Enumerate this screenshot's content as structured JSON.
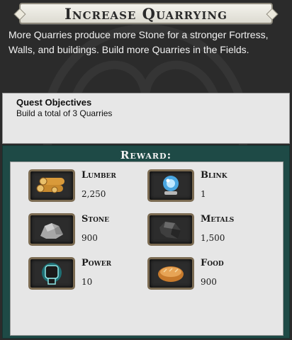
{
  "quest": {
    "title": "Increase Quarrying",
    "description": "More Quarries produce more Stone for a stronger Fortress, Walls, and buildings. Build more Quarries in the Fields."
  },
  "objectives": {
    "heading": "Quest Objectives",
    "items": [
      "Build a total of 3 Quarries"
    ]
  },
  "reward": {
    "title": "Reward:",
    "items": [
      {
        "name": "Lumber",
        "value": "2,250",
        "icon": "lumber-icon"
      },
      {
        "name": "Blink",
        "value": "1",
        "icon": "blink-orb-icon"
      },
      {
        "name": "Stone",
        "value": "900",
        "icon": "stone-icon"
      },
      {
        "name": "Metals",
        "value": "1,500",
        "icon": "metals-ore-icon"
      },
      {
        "name": "Power",
        "value": "10",
        "icon": "power-fist-icon"
      },
      {
        "name": "Food",
        "value": "900",
        "icon": "bread-icon"
      }
    ]
  },
  "colors": {
    "background": "#2b2b2b",
    "reward_frame": "#1e4a46",
    "panel": "#e6e6e6",
    "icon_border": "#7b6b52"
  }
}
